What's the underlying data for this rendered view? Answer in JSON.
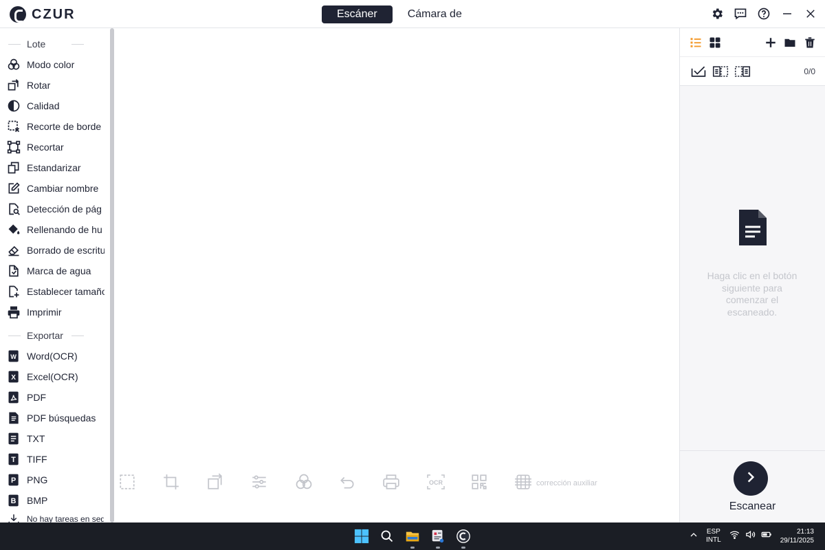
{
  "app": {
    "brand": "CZUR"
  },
  "mode_tabs": [
    {
      "label": "Escáner",
      "active": true
    },
    {
      "label": "Cámara de",
      "active": false
    }
  ],
  "sidebar": {
    "lote_header": "Lote",
    "lote_items": [
      {
        "label": "Modo color",
        "icon": "color-mode-icon"
      },
      {
        "label": "Rotar",
        "icon": "rotate-icon"
      },
      {
        "label": "Calidad",
        "icon": "quality-icon"
      },
      {
        "label": "Recorte de borde",
        "icon": "edge-crop-icon"
      },
      {
        "label": "Recortar",
        "icon": "crop-icon"
      },
      {
        "label": "Estandarizar",
        "icon": "standardize-icon"
      },
      {
        "label": "Cambiar nombre",
        "icon": "rename-icon"
      },
      {
        "label": "Detección de pág",
        "icon": "page-detect-icon"
      },
      {
        "label": "Rellenando de hu",
        "icon": "fill-icon"
      },
      {
        "label": "Borrado de escritu",
        "icon": "eraser-icon"
      },
      {
        "label": "Marca de agua",
        "icon": "watermark-icon"
      },
      {
        "label": "Establecer tamaño",
        "icon": "set-size-icon"
      },
      {
        "label": "Imprimir",
        "icon": "print-icon"
      }
    ],
    "export_header": "Exportar",
    "export_items": [
      {
        "label": "Word(OCR)",
        "icon": "word-icon",
        "glyph": "W"
      },
      {
        "label": "Excel(OCR)",
        "icon": "excel-icon",
        "glyph": "X"
      },
      {
        "label": "PDF",
        "icon": "pdf-icon",
        "glyph": ""
      },
      {
        "label": "PDF búsquedas",
        "icon": "searchable-pdf-icon",
        "glyph": ""
      },
      {
        "label": "TXT",
        "icon": "txt-icon",
        "glyph": ""
      },
      {
        "label": "TIFF",
        "icon": "tiff-icon",
        "glyph": "T"
      },
      {
        "label": "PNG",
        "icon": "png-icon",
        "glyph": "P"
      },
      {
        "label": "BMP",
        "icon": "bmp-icon",
        "glyph": "B"
      }
    ],
    "footer_status": "No hay tareas en seg"
  },
  "toolbar": {
    "tools": [
      "select-icon",
      "crop-icon",
      "rotate-icon",
      "adjust-icon",
      "color-mode-icon",
      "undo-icon",
      "print-icon",
      "ocr-icon",
      "qr-icon",
      "aux-correction-icon"
    ],
    "ocr_glyph": "OCR",
    "aux_label": "corrección auxiliar"
  },
  "right_panel": {
    "count": "0/0",
    "empty_message": "Haga clic en el botón siguiente para comenzar el escaneado.",
    "scan_label": "Escanear"
  },
  "taskbar": {
    "lang_line1": "ESP",
    "lang_line2": "INTL",
    "time": "21:13",
    "date": "29/11/2025"
  },
  "colors": {
    "accent_dark": "#1f2333",
    "list_view_active": "#f39a2b",
    "disabled_gray": "#c3c5cb"
  }
}
